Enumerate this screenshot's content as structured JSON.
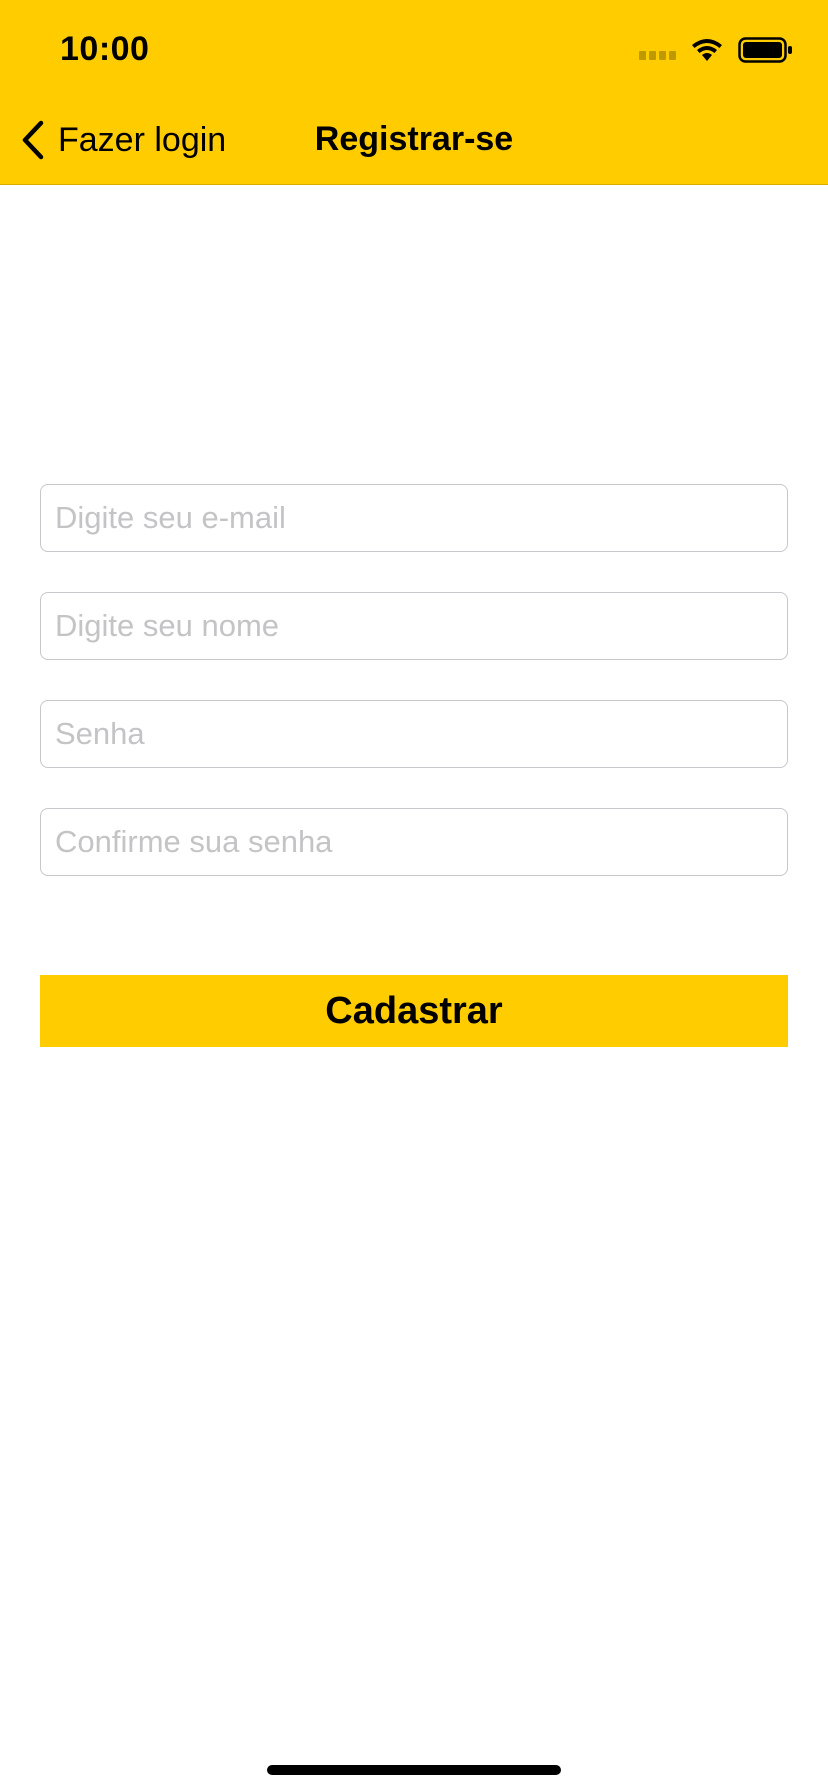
{
  "status_bar": {
    "time": "10:00"
  },
  "nav": {
    "back_label": "Fazer login",
    "title": "Registrar-se"
  },
  "form": {
    "email_placeholder": "Digite seu e-mail",
    "name_placeholder": "Digite seu nome",
    "password_placeholder": "Senha",
    "confirm_placeholder": "Confirme sua senha",
    "submit_label": "Cadastrar"
  },
  "colors": {
    "accent": "#FFCC00",
    "placeholder": "#c4c4c6",
    "field_border": "#c7c7cc"
  },
  "icons": [
    "chevron-left-icon",
    "cellular-signal-icon",
    "wifi-icon",
    "battery-icon"
  ]
}
